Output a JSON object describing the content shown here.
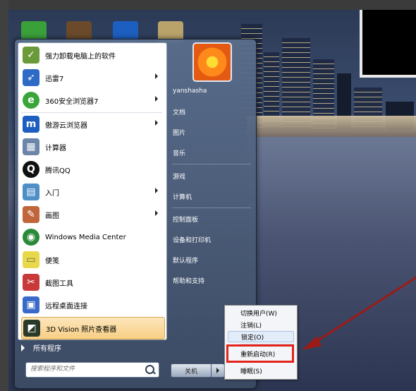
{
  "start_menu": {
    "programs": [
      {
        "label": "强力卸载电脑上的软件",
        "icon": "uninstaller-icon",
        "color": "#6a9a3a",
        "arrow": false
      },
      {
        "label": "迅雷7",
        "icon": "thunder-icon",
        "color": "#2e6ac6",
        "arrow": true
      },
      {
        "label": "360安全浏览器7",
        "icon": "360-browser-icon",
        "color": "#3aa63a",
        "arrow": true
      },
      {
        "label": "傲游云浏览器",
        "icon": "maxthon-icon",
        "color": "#1d5fc0",
        "arrow": true
      },
      {
        "label": "计算器",
        "icon": "calculator-icon",
        "color": "#6b86a8",
        "arrow": false
      },
      {
        "label": "腾讯QQ",
        "icon": "qq-icon",
        "color": "#111111",
        "arrow": false
      },
      {
        "label": "入门",
        "icon": "getting-started-icon",
        "color": "#4f8fc8",
        "arrow": true
      },
      {
        "label": "画图",
        "icon": "paint-icon",
        "color": "#c0663a",
        "arrow": true
      },
      {
        "label": "Windows Media Center",
        "icon": "media-center-icon",
        "color": "#2a8a3a",
        "arrow": false
      },
      {
        "label": "便笺",
        "icon": "sticky-notes-icon",
        "color": "#e8d84a",
        "arrow": false
      },
      {
        "label": "截图工具",
        "icon": "snipping-tool-icon",
        "color": "#c83a3a",
        "arrow": false
      },
      {
        "label": "远程桌面连接",
        "icon": "remote-desktop-icon",
        "color": "#3a6ac8",
        "arrow": false
      },
      {
        "label": "3D Vision 照片查看器",
        "icon": "3d-vision-icon",
        "color": "#2a3a2a",
        "arrow": true
      }
    ],
    "all_programs": "所有程序",
    "search_placeholder": "搜索程序和文件",
    "right_items": [
      "yanshasha",
      "文档",
      "图片",
      "音乐",
      "游戏",
      "计算机",
      "控制面板",
      "设备和打印机",
      "默认程序",
      "帮助和支持"
    ],
    "shutdown_label": "关机"
  },
  "context_menu": {
    "items": [
      "切换用户(W)",
      "注销(L)",
      "锁定(O)",
      "重新启动(R)",
      "睡眠(S)"
    ]
  },
  "colors": {
    "highlight_box": "#e3241c",
    "arrow": "#9c1b17"
  }
}
